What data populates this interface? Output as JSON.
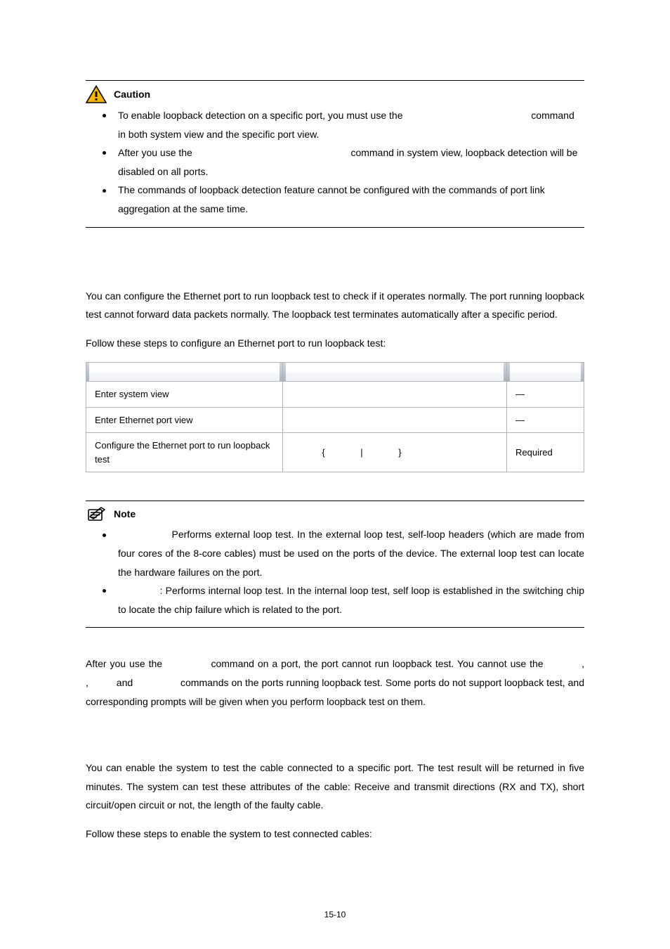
{
  "callout_caution": {
    "title": "Caution",
    "icon_fill": "#F7B500",
    "items": [
      "To enable loopback detection on a specific port, you must use the                                               command in both system view and the specific port view.",
      "After you use the                                                          command in system view, loopback detection will be disabled on all ports.",
      "The commands of loopback detection feature cannot be configured with the commands of port link aggregation at the same time."
    ]
  },
  "loopback": {
    "para1": "You can configure the Ethernet port to run loopback test to check if it operates normally. The port running loopback test cannot forward data packets normally. The loopback test terminates automatically after a specific period.",
    "para2": "Follow these steps to configure an Ethernet port to run loopback test:"
  },
  "table": {
    "headers": [
      "",
      "",
      ""
    ],
    "rows": [
      {
        "op": "Enter system view",
        "cmd": " ",
        "desc": "—"
      },
      {
        "op": "Enter Ethernet port view",
        "cmd": " ",
        "desc": "—"
      },
      {
        "op": "Configure the Ethernet port to run loopback test",
        "cmd": "            {              |              }",
        "desc": "Required"
      }
    ]
  },
  "callout_note": {
    "title": "Note",
    "items": [
      "                Performs external loop test. In the external loop test, self-loop headers (which are made from four cores of the 8-core cables) must be used on the ports of the device. The external loop test can locate the hardware failures on the port.",
      "              : Performs internal loop test. In the internal loop test, self loop is established in the switching chip to locate the chip failure which is related to the port."
    ]
  },
  "after_note": "After you use the              command on a port, the port cannot run loopback test. You cannot use the           ,           ,          and                 commands on the ports running loopback test. Some ports do not support loopback test, and corresponding prompts will be given when you perform loopback test on them.",
  "cable": {
    "para1": "You can enable the system to test the cable connected to a specific port. The test result will be returned in five minutes. The system can test these attributes of the cable: Receive and transmit directions (RX and TX), short circuit/open circuit or not, the length of the faulty cable.",
    "para2": "Follow these steps to enable the system to test connected cables:"
  },
  "page_number": "15-10"
}
